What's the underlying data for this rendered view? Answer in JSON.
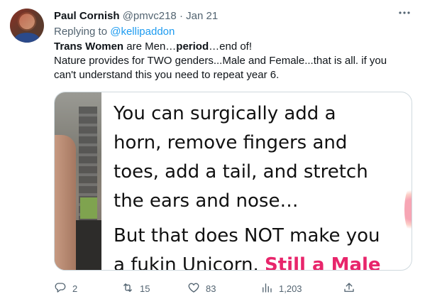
{
  "tweet": {
    "author_name": "Paul Cornish",
    "handle": "@pmvc218",
    "separator": "·",
    "date": "Jan 21",
    "more_icon": "more-dots-icon",
    "replying_prefix": "Replying to",
    "replying_to": "@kellipaddon",
    "text": {
      "line1_bold_a": "Trans Women",
      "line1_plain_a": " are Men…",
      "line1_bold_b": "period",
      "line1_plain_b": "…end of!",
      "line2": "Nature provides for TWO genders...Male and Female...that is all. if you can't understand this you need to repeat year 6."
    },
    "media": {
      "meme_line1": "You can surgically add a",
      "meme_line2": "horn, remove fingers and",
      "meme_line3": "toes, add a tail, and stretch",
      "meme_line4": "the ears and nose…",
      "meme_line5": "But that does NOT make you",
      "meme_line6_plain": "a fukin Unicorn. ",
      "meme_line6_pink": "Still a Male",
      "pink_color": "#e8256b"
    },
    "actions": {
      "reply_icon": "reply-icon",
      "reply_count": "2",
      "retweet_icon": "retweet-icon",
      "retweet_count": "15",
      "like_icon": "heart-icon",
      "like_count": "83",
      "views_icon": "views-chart-icon",
      "views_count": "1,203",
      "share_icon": "share-icon"
    },
    "colors": {
      "link": "#1d9bf0",
      "secondary_text": "#536471",
      "primary_text": "#0f1419",
      "border": "#cfd9de"
    }
  }
}
